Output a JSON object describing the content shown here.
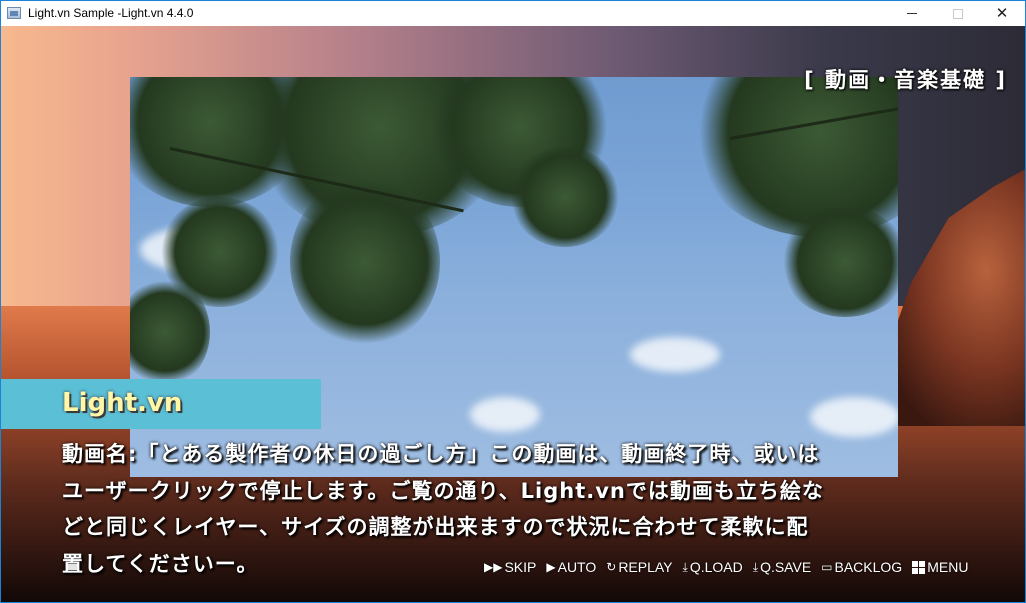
{
  "window": {
    "title": "Light.vn Sample -Light.vn 4.4.0",
    "controls": {
      "minimize": "minimize",
      "maximize": "maximize",
      "close": "✕"
    }
  },
  "scene": {
    "chapter_label": "[ 動画・音楽基礎 ]"
  },
  "dialog": {
    "speaker": "Light.vn",
    "lines": [
      "動画名:「とある製作者の休日の過ごし方」この動画は、動画終了時、或いは",
      "ユーザークリックで停止します。ご覧の通り、Light.vnでは動画も立ち絵な",
      "どと同じくレイヤー、サイズの調整が出来ますので状況に合わせて柔軟に配",
      "置してくださいー。"
    ]
  },
  "quick_menu": [
    {
      "label": "SKIP",
      "icon": "skip-icon",
      "glyph": "▶▶"
    },
    {
      "label": "AUTO",
      "icon": "auto-icon",
      "glyph": "▶"
    },
    {
      "label": "REPLAY",
      "icon": "replay-icon",
      "glyph": "↻"
    },
    {
      "label": "Q.LOAD",
      "icon": "quick-load-icon",
      "glyph": "⤓"
    },
    {
      "label": "Q.SAVE",
      "icon": "quick-save-icon",
      "glyph": "⤓"
    },
    {
      "label": "BACKLOG",
      "icon": "backlog-icon",
      "glyph": "▭"
    },
    {
      "label": "MENU",
      "icon": "menu-grid-icon",
      "glyph": ""
    }
  ],
  "colors": {
    "namebox": "#5bbfd6",
    "speaker_text": "#fff6a8",
    "window_border": "#1883d7"
  }
}
